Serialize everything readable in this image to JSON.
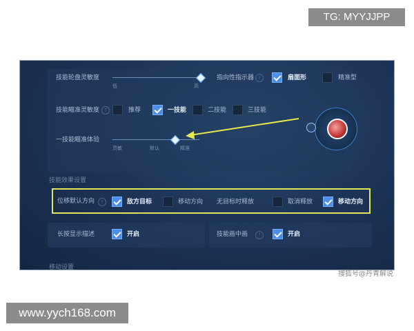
{
  "watermarks": {
    "top": "TG: MYYJJPP",
    "bottom": "www.yych168.com",
    "credit": "搜狐号@丹青解说"
  },
  "settings": {
    "row1": {
      "label": "技能轮盘灵敏度",
      "slider_low": "低",
      "slider_high": "高",
      "slider_level": 1.0,
      "indicator_label": "指向性指示器",
      "opt1": "扇面形",
      "opt2": "精准型"
    },
    "row2": {
      "label": "技能瞄准灵敏度",
      "options": [
        "推荐",
        "一技能",
        "二技能",
        "三技能"
      ]
    },
    "row3": {
      "label": "一技能瞄准体验",
      "slider_labels": [
        "灵敏",
        "默认",
        "精准"
      ],
      "slider_level": 0.7
    },
    "section_title": "技能效果设置",
    "highlight_row": {
      "label": "位移默认方向",
      "opt1": "敌方目标",
      "opt2": "移动方向",
      "label2": "无目标时释放",
      "opt3": "取消释放",
      "opt4": "移动方向"
    },
    "row5": {
      "label": "长按显示描述",
      "option": "开启",
      "label2": "技能画中画",
      "option2": "开启"
    },
    "bottom_section": "移动设置"
  },
  "colors": {
    "accent": "#4d8ee6",
    "highlight": "#e3e65a",
    "arrow": "#e6e84d"
  }
}
